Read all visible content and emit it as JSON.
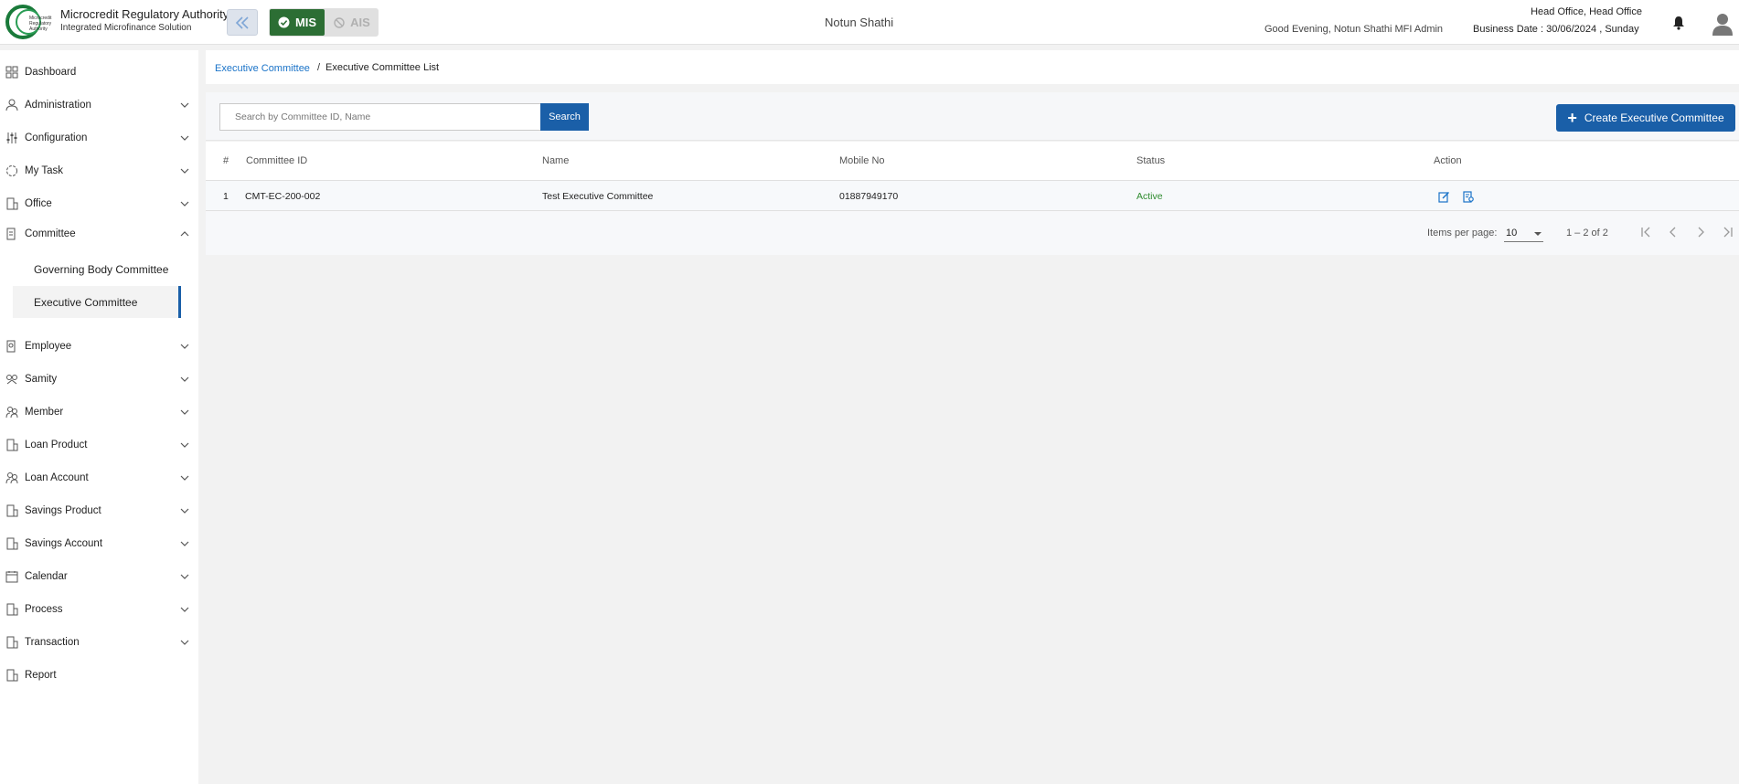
{
  "header": {
    "logo_text": "Microcredit Regulatory Authority",
    "brand_title": "Microcredit Regulatory Authority",
    "brand_subtitle": "Integrated Microfinance Solution",
    "mode_mis": "MIS",
    "mode_ais": "AIS",
    "center_title": "Notun Shathi",
    "greeting": "Good Evening, Notun Shathi MFI Admin",
    "office": "Head Office, Head Office",
    "business_date": "Business Date : 30/06/2024 , Sunday"
  },
  "sidebar": {
    "items": [
      {
        "label": "Dashboard",
        "icon": "dashboard-icon"
      },
      {
        "label": "Administration",
        "icon": "administration-icon"
      },
      {
        "label": "Configuration",
        "icon": "configuration-icon"
      },
      {
        "label": "My Task",
        "icon": "task-icon"
      },
      {
        "label": "Office",
        "icon": "office-icon"
      },
      {
        "label": "Committee",
        "icon": "committee-icon"
      },
      {
        "label": "Employee",
        "icon": "employee-icon"
      },
      {
        "label": "Samity",
        "icon": "samity-icon"
      },
      {
        "label": "Member",
        "icon": "member-icon"
      },
      {
        "label": "Loan Product",
        "icon": "loan-product-icon"
      },
      {
        "label": "Loan Account",
        "icon": "loan-account-icon"
      },
      {
        "label": "Savings Product",
        "icon": "savings-product-icon"
      },
      {
        "label": "Savings Account",
        "icon": "savings-account-icon"
      },
      {
        "label": "Calendar",
        "icon": "calendar-icon"
      },
      {
        "label": "Process",
        "icon": "process-icon"
      },
      {
        "label": "Transaction",
        "icon": "transaction-icon"
      },
      {
        "label": "Report",
        "icon": "report-icon"
      }
    ],
    "committee_sub": [
      {
        "label": "Governing Body Committee"
      },
      {
        "label": "Executive Committee"
      }
    ]
  },
  "breadcrumb": {
    "parent": "Executive Committee",
    "separator": "/",
    "current": "Executive Committee List"
  },
  "toolbar": {
    "search_placeholder": "Search by Committee ID, Name",
    "search_label": "Search",
    "create_label": "Create Executive Committee"
  },
  "table": {
    "columns": [
      "#",
      "Committee ID",
      "Name",
      "Mobile No",
      "Status",
      "Action"
    ],
    "rows": [
      {
        "index": "1",
        "committee_id": "CMT-EC-200-002",
        "name": "Test Executive Committee",
        "mobile": "01887949170",
        "status": "Active"
      }
    ]
  },
  "paginator": {
    "items_per_page_label": "Items per page:",
    "page_size": "10",
    "range": "1 – 2 of 2"
  },
  "colors": {
    "primary": "#1a5fa8",
    "mis_green": "#2c6e34",
    "status_active": "#2e8b2e",
    "link": "#1a73c8"
  }
}
